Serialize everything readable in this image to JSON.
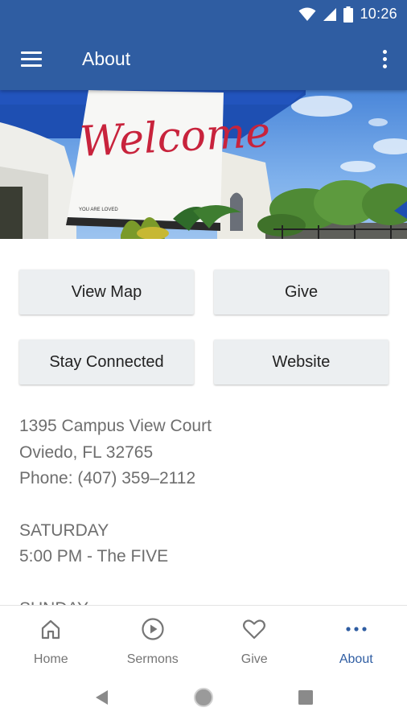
{
  "status_bar": {
    "time": "10:26"
  },
  "app_bar": {
    "title": "About"
  },
  "hero": {
    "banner_text": "Welcome",
    "banner_subtext": "YOU ARE LOVED"
  },
  "actions": {
    "view_map": "View Map",
    "give": "Give",
    "stay_connected": "Stay Connected",
    "website": "Website"
  },
  "info": {
    "address_line1": "1395 Campus View Court",
    "address_line2": "Oviedo, FL 32765",
    "phone": "Phone: (407) 359–2112",
    "service1_day": "SATURDAY",
    "service1_time": "5:00 PM - The FIVE",
    "service2_day": "SUNDAY"
  },
  "bottom_nav": {
    "items": [
      {
        "label": "Home",
        "icon": "home-icon"
      },
      {
        "label": "Sermons",
        "icon": "play-circle-icon"
      },
      {
        "label": "Give",
        "icon": "heart-icon"
      },
      {
        "label": "About",
        "icon": "more-horiz-icon"
      }
    ],
    "active": "About"
  },
  "colors": {
    "primary": "#2f5da2",
    "button_bg": "#eceff1",
    "banner_script": "#c8233c",
    "text_muted": "#6e6e6e",
    "inactive_tab": "#757575"
  }
}
